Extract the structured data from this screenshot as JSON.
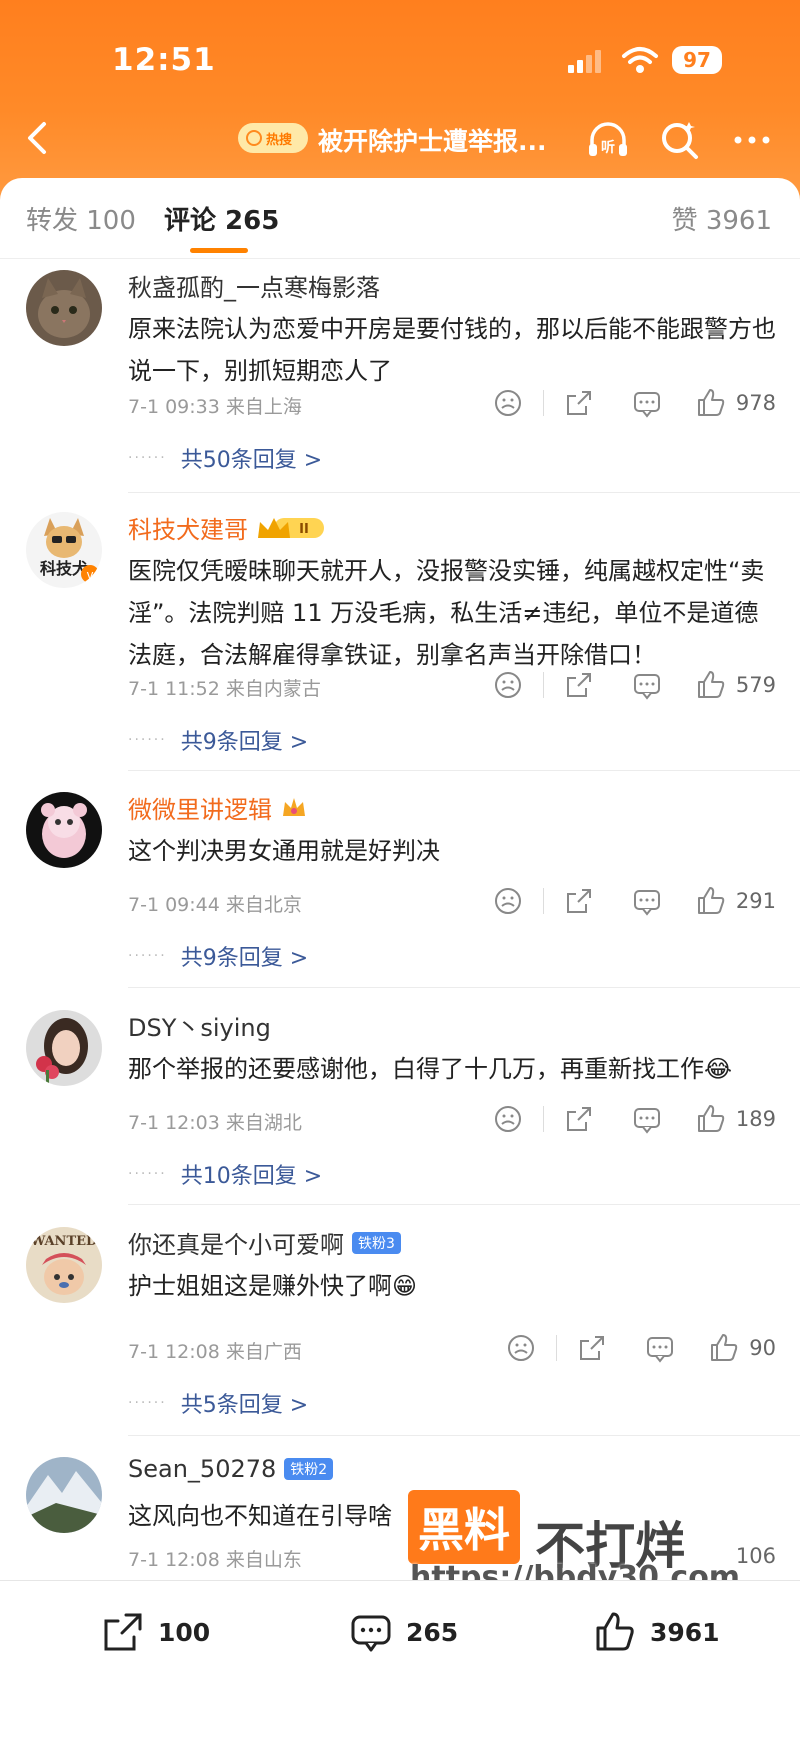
{
  "status_bar": {
    "time": "12:51",
    "battery": "97"
  },
  "nav": {
    "hot_tag": "热搜",
    "title": "被开除护士遭举报..."
  },
  "tabs": {
    "repost": "转发 100",
    "comment": "评论 265",
    "likes": "赞 3961"
  },
  "comments": [
    {
      "user": "秋盏孤酌_一点寒梅影落",
      "text": "原来法院认为恋爱中开房是要付钱的，那以后能不能跟警方也说一下，别抓短期恋人了",
      "time": "7-1 09:33",
      "location": "来自上海",
      "likes": "978",
      "replies": "共50条回复 >"
    },
    {
      "user": "科技犬建哥",
      "badge": "II",
      "text": "医院仅凭暧昧聊天就开人，没报警没实锤，纯属越权定性“卖淫”。法院判赔 11 万没毛病，私生活≠违纪，单位不是道德法庭，合法解雇得拿铁证，别拿名声当开除借口！",
      "time": "7-1 11:52",
      "location": "来自内蒙古",
      "likes": "579",
      "replies": "共9条回复 >"
    },
    {
      "user": "微微里讲逻辑",
      "text": "这个判决男女通用就是好判决",
      "time": "7-1 09:44",
      "location": "来自北京",
      "likes": "291",
      "replies": "共9条回复 >"
    },
    {
      "user": "DSY丶siying",
      "text": "那个举报的还要感谢他，白得了十几万，再重新找工作😂",
      "time": "7-1 12:03",
      "location": "来自湖北",
      "likes": "189",
      "replies": "共10条回复 >"
    },
    {
      "user": "你还真是个小可爱啊",
      "badge": "铁粉3",
      "text": "护士姐姐这是赚外快了啊😁",
      "time": "7-1 12:08",
      "location": "来自广西",
      "likes": "90",
      "replies": "共5条回复 >"
    },
    {
      "user": "Sean_50278",
      "badge": "铁粉2",
      "text": "这风向也不知道在引导啥",
      "time": "7-1 12:08",
      "location": "来自山东",
      "likes": "106"
    }
  ],
  "bottom_bar": {
    "repost": "100",
    "comment": "265",
    "like": "3961"
  },
  "watermark": {
    "brand": "黑料",
    "slogan": "不打烊",
    "url": "https://bbdy30.com"
  },
  "colors": {
    "header": "#ff8a28",
    "accent": "#ff8200",
    "link": "#3b5998",
    "orange_name": "#f26b1d"
  },
  "icons": [
    "back-icon",
    "listen-icon",
    "search-icon",
    "more-icon",
    "emoji-icon",
    "share-icon",
    "reply-icon",
    "like-icon"
  ]
}
